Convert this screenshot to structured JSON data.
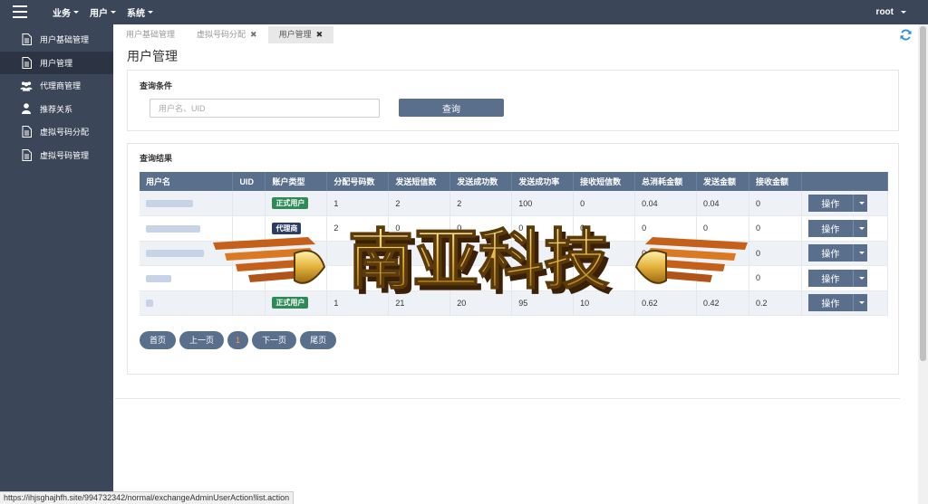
{
  "topbar": {
    "menu": [
      {
        "label": "业务"
      },
      {
        "label": "用户"
      },
      {
        "label": "系统"
      }
    ],
    "user": "root"
  },
  "sidebar": {
    "items": [
      {
        "label": "用户基础管理",
        "icon": "document-icon"
      },
      {
        "label": "用户管理",
        "icon": "document-icon",
        "active": true
      },
      {
        "label": "代理商管理",
        "icon": "users-icon"
      },
      {
        "label": "推荐关系",
        "icon": "user-icon"
      },
      {
        "label": "虚拟号码分配",
        "icon": "document-icon"
      },
      {
        "label": "虚拟号码管理",
        "icon": "document-icon"
      }
    ]
  },
  "tabs": [
    {
      "label": "用户基础管理",
      "closable": false
    },
    {
      "label": "虚拟号码分配",
      "closable": true
    },
    {
      "label": "用户管理",
      "closable": true,
      "active": true
    }
  ],
  "page": {
    "title": "用户管理"
  },
  "query": {
    "title": "查询条件",
    "placeholder": "用户名、UID",
    "button": "查询"
  },
  "results": {
    "title": "查询结果",
    "columns": [
      "用户名",
      "UID",
      "账户类型",
      "分配号码数",
      "发送短信数",
      "发送成功数",
      "发送成功率",
      "接收短信数",
      "总消耗金额",
      "发送金额",
      "接收金额",
      ""
    ],
    "rows": [
      {
        "type": "正式用户",
        "type_color": "green",
        "assigned": "1",
        "sent": "2",
        "success": "2",
        "rate": "100",
        "received": "0",
        "total": "0.04",
        "send_amt": "0.04",
        "recv_amt": "0"
      },
      {
        "type": "代理商",
        "type_color": "navy",
        "assigned": "2",
        "sent": "0",
        "success": "0",
        "rate": "0",
        "received": "0",
        "total": "0",
        "send_amt": "0",
        "recv_amt": "0"
      },
      {
        "type": "",
        "type_color": "",
        "assigned": "",
        "sent": "0",
        "success": "0",
        "rate": "",
        "received": "",
        "total": "0",
        "send_amt": "",
        "recv_amt": "0"
      },
      {
        "type": "",
        "type_color": "",
        "assigned": "",
        "sent": "",
        "success": "",
        "rate": "",
        "received": "",
        "total": "",
        "send_amt": "",
        "recv_amt": "0"
      },
      {
        "type": "正式用户",
        "type_color": "green",
        "assigned": "1",
        "sent": "21",
        "success": "20",
        "rate": "95",
        "received": "10",
        "total": "0.62",
        "send_amt": "0.42",
        "recv_amt": "0.2"
      }
    ],
    "action_label": "操作"
  },
  "pager": {
    "first": "首页",
    "prev": "上一页",
    "current": "1",
    "next": "下一页",
    "last": "尾页"
  },
  "watermark": {
    "text": "南亚科技"
  },
  "status_url": "https://ihjsghajhfh.site/994732342/normal/exchangeAdminUserAction!list.action",
  "colors": {
    "nav_bg": "#3b4658",
    "header_blue": "#5a6f8c",
    "badge_green": "#2e8b57",
    "badge_navy": "#2c3e66",
    "refresh_blue": "#2a8fd6"
  }
}
